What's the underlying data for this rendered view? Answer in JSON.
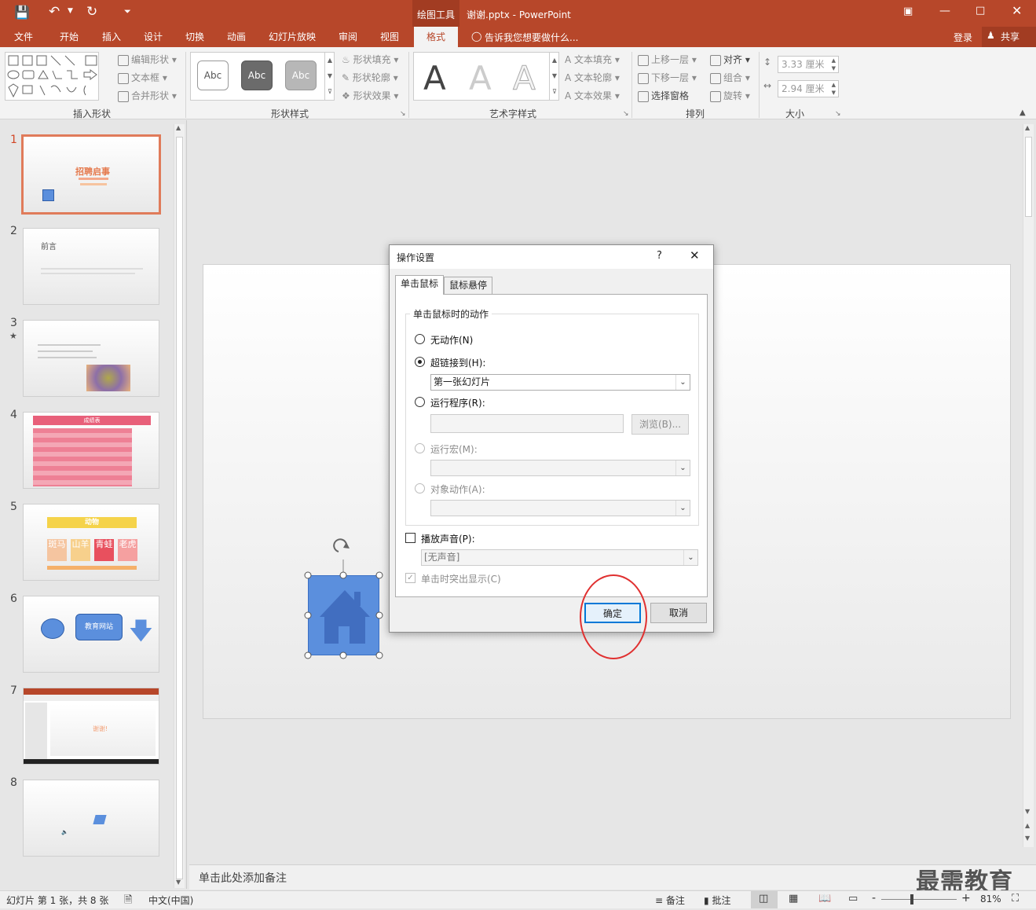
{
  "app": {
    "title": "谢谢.pptx - PowerPoint",
    "context_tab": "绘图工具",
    "signin": "登录",
    "share": "共享",
    "colors": {
      "accent": "#b7472a",
      "selection": "#e07b5a",
      "shape_fill": "#5b8fdd",
      "dialog_highlight": "#e03030"
    }
  },
  "tabs": [
    "文件",
    "开始",
    "插入",
    "设计",
    "切换",
    "动画",
    "幻灯片放映",
    "审阅",
    "视图",
    "格式"
  ],
  "active_tab": "格式",
  "tell_me": "告诉我您想要做什么...",
  "ribbon": {
    "insert_shapes": {
      "label": "插入形状",
      "edit_shape": "编辑形状",
      "text_box": "文本框",
      "merge_shapes": "合并形状"
    },
    "shape_styles": {
      "label": "形状样式",
      "style_sample": "Abc",
      "fill": "形状填充",
      "outline": "形状轮廓",
      "effects": "形状效果"
    },
    "wordart": {
      "label": "艺术字样式",
      "sample": "A",
      "text_fill": "文本填充",
      "text_outline": "文本轮廓",
      "text_effects": "文本效果"
    },
    "arrange": {
      "label": "排列",
      "bring_forward": "上移一层",
      "send_backward": "下移一层",
      "selection_pane": "选择窗格",
      "align": "对齐",
      "group": "组合",
      "rotate": "旋转"
    },
    "size": {
      "label": "大小",
      "height": "3.33 厘米",
      "width": "2.94 厘米"
    }
  },
  "slides": [
    {
      "num": "1",
      "title": "招聘启事"
    },
    {
      "num": "2",
      "title": "前言"
    },
    {
      "num": "3",
      "title": ""
    },
    {
      "num": "4",
      "title": "成绩表"
    },
    {
      "num": "5",
      "title": "动物"
    },
    {
      "num": "6",
      "title": "教育网站"
    },
    {
      "num": "7",
      "title": "谢谢!"
    },
    {
      "num": "8",
      "title": ""
    }
  ],
  "slide4_tiles": [
    "斑马",
    "山羊",
    "青蛙",
    "老虎"
  ],
  "dialog": {
    "title": "操作设置",
    "help": "?",
    "tabs": [
      "单击鼠标",
      "鼠标悬停"
    ],
    "group_label": "单击鼠标时的动作",
    "no_action": "无动作(N)",
    "hyperlink": "超链接到(H):",
    "hyperlink_value": "第一张幻灯片",
    "run_program": "运行程序(R):",
    "browse": "浏览(B)...",
    "run_macro": "运行宏(M):",
    "object_action": "对象动作(A):",
    "play_sound": "播放声音(P):",
    "sound_value": "[无声音]",
    "highlight": "单击时突出显示(C)",
    "ok": "确定",
    "cancel": "取消"
  },
  "notes_placeholder": "单击此处添加备注",
  "status": {
    "slide_info": "幻灯片 第 1 张，共 8 张",
    "language": "中文(中国)",
    "notes": "备注",
    "comments": "批注",
    "zoom": "81%"
  },
  "watermark": "最需教育"
}
